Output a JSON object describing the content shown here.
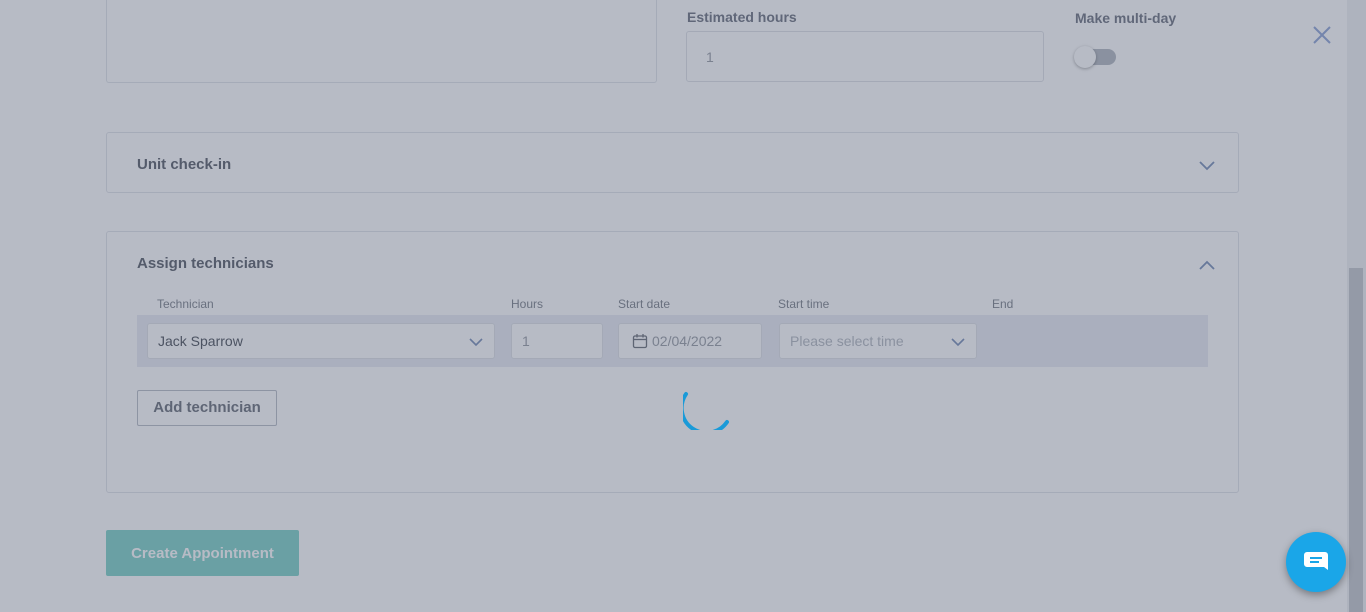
{
  "top": {
    "estimated_hours_label": "Estimated hours",
    "estimated_hours_value": "1",
    "multi_day_label": "Make multi-day",
    "multi_day_enabled": false
  },
  "unit_checkin": {
    "title": "Unit check-in",
    "expanded": false
  },
  "assign": {
    "title": "Assign technicians",
    "expanded": true,
    "columns": [
      "Technician",
      "Hours",
      "Start date",
      "Start time",
      "End"
    ],
    "row": {
      "technician": "Jack Sparrow",
      "hours": "1",
      "start_date": "02/04/2022",
      "start_time_placeholder": "Please select time",
      "end": ""
    },
    "add_button": "Add technician"
  },
  "create_button": "Create Appointment",
  "colors": {
    "accent": "#1aa6e8",
    "create_button": "#7fd3c8",
    "overlay": "#4a546e"
  },
  "icons": {
    "close": "close-icon",
    "chat": "chat-icon",
    "calendar": "calendar-icon",
    "spinner": "loading-spinner"
  }
}
